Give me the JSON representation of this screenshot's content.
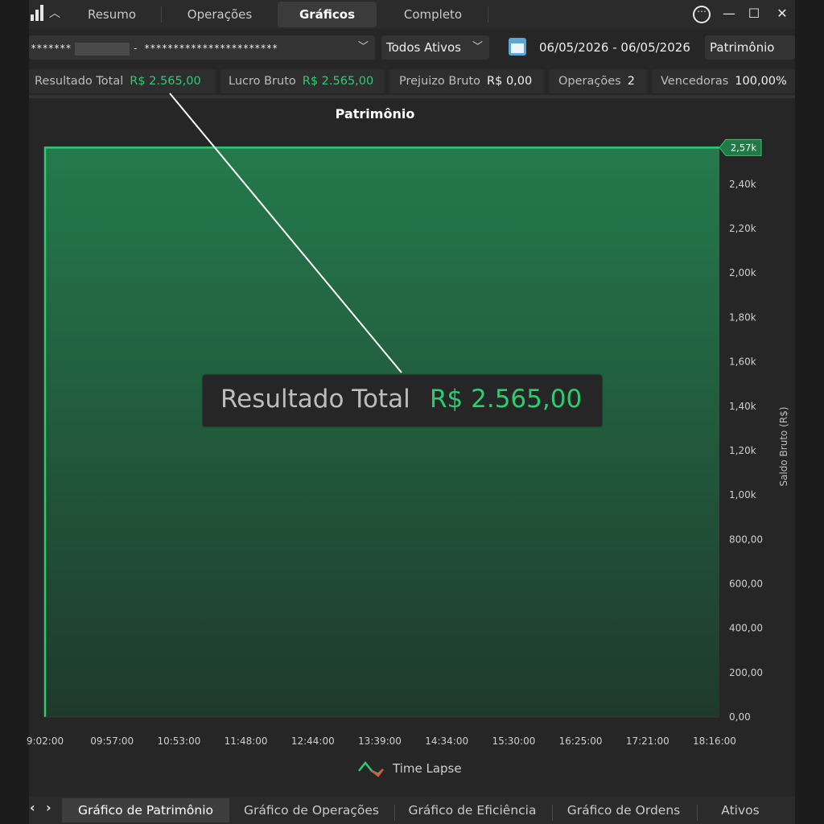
{
  "tabs": {
    "resumo": "Resumo",
    "operacoes": "Operações",
    "graficos": "Gráficos",
    "completo": "Completo"
  },
  "window": {
    "more": "⋯",
    "minimize": "—",
    "maximize": "☐",
    "close": "✕"
  },
  "filters": {
    "account_prefix": "*******",
    "account_suffix": "- ***********************",
    "assets": "Todos Ativos",
    "date_range": "06/05/2026 - 06/05/2026",
    "view": "Patrimônio"
  },
  "stats": {
    "resultado_total": {
      "label": "Resultado Total",
      "value": "R$ 2.565,00"
    },
    "lucro_bruto": {
      "label": "Lucro Bruto",
      "value": "R$ 2.565,00"
    },
    "prejuizo_bruto": {
      "label": "Prejuizo Bruto",
      "value": "R$ 0,00"
    },
    "operacoes": {
      "label": "Operações",
      "value": "2"
    },
    "vencedoras": {
      "label": "Vencedoras",
      "value": "100,00%"
    }
  },
  "callout": {
    "label": "Resultado Total",
    "value": "R$ 2.565,00"
  },
  "chart_data": {
    "type": "area",
    "title": "Patrimônio",
    "ylabel": "Saldo Bruto (R$)",
    "xlabel": "",
    "ylim": [
      0,
      2570
    ],
    "y_ticks": [
      "0,00",
      "200,00",
      "400,00",
      "600,00",
      "800,00",
      "1,00k",
      "1,20k",
      "1,40k",
      "1,60k",
      "1,80k",
      "2,00k",
      "2,20k",
      "2,40k"
    ],
    "y_tick_values": [
      0,
      200,
      400,
      600,
      800,
      1000,
      1200,
      1400,
      1600,
      1800,
      2000,
      2200,
      2400
    ],
    "x_ticks": [
      "9:02:00",
      "09:57:00",
      "10:53:00",
      "11:48:00",
      "12:44:00",
      "13:39:00",
      "14:34:00",
      "15:30:00",
      "16:25:00",
      "17:21:00",
      "18:16:00"
    ],
    "current_value_label": "2,57k",
    "series": [
      {
        "name": "Time Lapse",
        "x": [
          "9:02:00",
          "9:02:00",
          "18:16:00"
        ],
        "values": [
          0,
          2565,
          2565
        ]
      }
    ],
    "line_color": "#2ecc71",
    "grid": true,
    "legend": "bottom-center"
  },
  "bottom_tabs": {
    "prev": "‹",
    "next": "›",
    "patrimonio": "Gráfico de Patrimônio",
    "operacoes": "Gráfico de Operações",
    "eficiencia": "Gráfico de Eficiência",
    "ordens": "Gráfico de Ordens",
    "ativos": "Ativos"
  }
}
